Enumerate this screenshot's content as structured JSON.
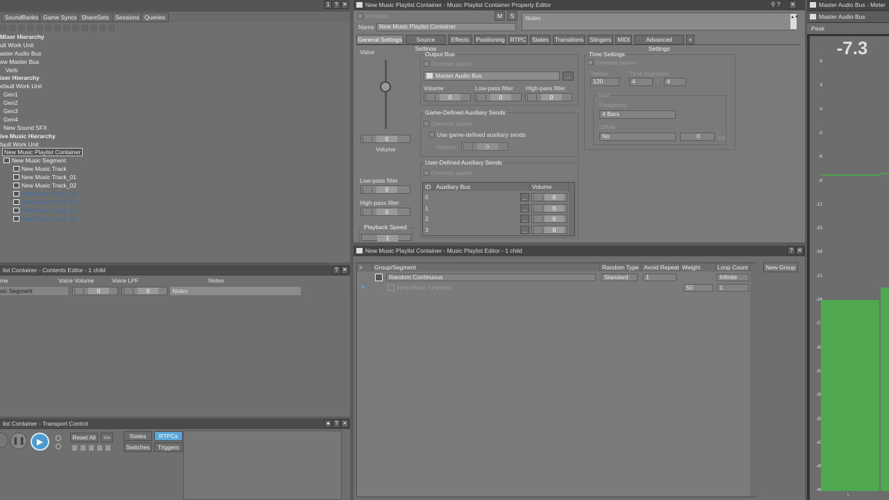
{
  "left_tabs": [
    "SoundBanks",
    "Game Syncs",
    "ShareSets",
    "Sessions",
    "Queries"
  ],
  "left_tab_buttons": [
    "1",
    "?",
    "✕"
  ],
  "tree": [
    {
      "label": "Mixer Hierarchy",
      "indent": 0,
      "bold": true,
      "icon": false,
      "blue": false
    },
    {
      "label": "ult Work Unit",
      "indent": 0,
      "bold": false,
      "icon": false,
      "blue": false
    },
    {
      "label": "aster Audio Bus",
      "indent": 0,
      "bold": false,
      "icon": false,
      "blue": false
    },
    {
      "label": "ew Master Bus",
      "indent": 0,
      "bold": false,
      "icon": false,
      "blue": false
    },
    {
      "label": "Verb",
      "indent": 8,
      "bold": false,
      "icon": false,
      "blue": false
    },
    {
      "label": "ixer Hierarchy",
      "indent": 0,
      "bold": true,
      "icon": false,
      "blue": false
    },
    {
      "label": "efault Work Unit",
      "indent": 0,
      "bold": false,
      "icon": false,
      "blue": false
    },
    {
      "label": "Gen1",
      "indent": 5,
      "bold": false,
      "icon": false,
      "blue": false
    },
    {
      "label": "Gen2",
      "indent": 5,
      "bold": false,
      "icon": false,
      "blue": false
    },
    {
      "label": "Gen3",
      "indent": 5,
      "bold": false,
      "icon": false,
      "blue": false
    },
    {
      "label": "Gen4",
      "indent": 5,
      "bold": false,
      "icon": false,
      "blue": false
    },
    {
      "label": "New Sound SFX",
      "indent": 5,
      "bold": false,
      "icon": false,
      "blue": false
    },
    {
      "label": "ive Music Hierarchy",
      "indent": 0,
      "bold": true,
      "icon": false,
      "blue": false
    },
    {
      "label": "fault Work Unit",
      "indent": 0,
      "bold": false,
      "icon": false,
      "blue": false
    },
    {
      "label": "New Music Playlist Container",
      "indent": 3,
      "bold": false,
      "icon": false,
      "blue": false,
      "selected": true
    },
    {
      "label": "New Music Segment",
      "indent": 5,
      "bold": false,
      "icon": true,
      "blue": false
    },
    {
      "label": "New Music Track",
      "indent": 19,
      "bold": false,
      "icon": true,
      "blue": false
    },
    {
      "label": "New Music Track_01",
      "indent": 19,
      "bold": false,
      "icon": true,
      "blue": false
    },
    {
      "label": "New Music Track_02",
      "indent": 19,
      "bold": false,
      "icon": true,
      "blue": false
    },
    {
      "label": "New Music Track_03",
      "indent": 19,
      "bold": false,
      "icon": true,
      "blue": true
    },
    {
      "label": "New Music Track_04",
      "indent": 19,
      "bold": false,
      "icon": true,
      "blue": true
    },
    {
      "label": "New Music Track_05",
      "indent": 19,
      "bold": false,
      "icon": true,
      "blue": true
    },
    {
      "label": "New Music Track_06",
      "indent": 19,
      "bold": false,
      "icon": true,
      "blue": true
    }
  ],
  "contents": {
    "title": "list Container - Contents Editor - 1 child",
    "col_name": "me",
    "col_voice_volume": "Voice Volume",
    "col_voice_lpf": "Voice LPF",
    "col_notes": "Notes",
    "row_name": "sic Segment",
    "row_volume": "0",
    "row_lpf": "0",
    "row_notes": "Notes"
  },
  "transport": {
    "title": "list Container - Transport Control",
    "reset_all": "Reset All",
    "more": ">>",
    "states": "States",
    "rtpcs": "RTPCs",
    "switches": "Switches",
    "triggers": "Triggers"
  },
  "prop": {
    "title": "New Music Playlist Container - Music Playlist Container Property Editor",
    "inclusion": "Inclusion",
    "m_btn": "M",
    "s_btn": "S",
    "name_label": "Name",
    "name_value": "New Music Playlist Container",
    "notes_placeholder": "Notes",
    "tabs": [
      "General Settings",
      "Source Settings",
      "Effects",
      "Positioning",
      "RTPC",
      "States",
      "Transitions",
      "Stingers",
      "MIDI",
      "Advanced Settings",
      "+"
    ],
    "voice_group": "Voice",
    "voice_volume_value": "0",
    "voice_volume_label": "Volume",
    "lpf_label": "Low-pass filter",
    "lpf_value": "0",
    "hpf_label": "High-pass filter",
    "hpf_value": "0",
    "playback_speed_label": "Playback Speed",
    "playback_speed_value": "1",
    "output_bus_group": "Output Bus",
    "override_parent": "Override parent",
    "output_bus_value": "Master Audio Bus",
    "ellipsis": "...",
    "ob_volume_label": "Volume",
    "ob_volume_value": "0",
    "ob_lpf_label": "Low-pass filter",
    "ob_lpf_value": "0",
    "ob_hpf_label": "High-pass filter",
    "ob_hpf_value": "0",
    "game_aux_group": "Game-Defined Auxiliary Sends",
    "use_game_aux": "Use game-defined auxiliary sends",
    "game_aux_volume_label": "Volume",
    "game_aux_volume_value": "0",
    "user_aux_group": "User-Defined Auxiliary Sends",
    "aux_col_id": "ID",
    "aux_col_bus": "Auxiliary Bus",
    "aux_col_volume": "Volume",
    "aux_rows": [
      {
        "id": "0",
        "volume": "0"
      },
      {
        "id": "1",
        "volume": "0"
      },
      {
        "id": "2",
        "volume": "0"
      },
      {
        "id": "3",
        "volume": "0"
      }
    ],
    "time_group": "Time Settings",
    "tempo_label": "Tempo",
    "tempo_value": "120",
    "timesig_label": "Time Signature",
    "timesig_num": "4",
    "timesig_slash": "/",
    "timesig_den": "4",
    "grid_label": "Grid",
    "frequency_label": "Frequency",
    "frequency_value": "4 Bars",
    "offset_label": "Offset",
    "offset_value": "No",
    "offset_ms_value": "0",
    "offset_ms_unit": "ms"
  },
  "playlist": {
    "title": "New Music Playlist Container - Music Playlist Editor - 1 child",
    "col_arrow": ">",
    "col_group": "Group/Segment",
    "col_random": "Random Type",
    "col_avoid": "Avoid Repeat",
    "col_weight": "Weight",
    "col_loop": "Loop Count",
    "new_group": "New Group",
    "row1_type": "Random Continuous",
    "row1_random": "Standard",
    "row1_avoid": "1",
    "row1_loop": "Infinite",
    "row2_name": "New Music Segment",
    "row2_weight": "50",
    "row2_loop": "1"
  },
  "meter": {
    "title": "Master Audio Bus - Meter",
    "bus": "Master Audio Bus",
    "mode": "Peak",
    "value": "-7.3",
    "scale": [
      {
        "label": "6",
        "v": 6
      },
      {
        "label": "3",
        "v": 3
      },
      {
        "label": "0",
        "v": 0
      },
      {
        "label": "-3",
        "v": -3
      },
      {
        "label": "-6",
        "v": -6
      },
      {
        "label": "-9",
        "v": -9
      },
      {
        "label": "-12",
        "v": -12
      },
      {
        "label": "-15",
        "v": -15
      },
      {
        "label": "-18",
        "v": -18
      },
      {
        "label": "-21",
        "v": -21
      },
      {
        "label": "-24",
        "v": -24
      },
      {
        "label": "-27",
        "v": -27
      },
      {
        "label": "-30",
        "v": -30
      },
      {
        "label": "-33",
        "v": -33
      },
      {
        "label": "-36",
        "v": -36
      },
      {
        "label": "-39",
        "v": -39
      },
      {
        "label": "-42",
        "v": -42
      },
      {
        "label": "-45",
        "v": -45
      },
      {
        "label": "-48",
        "v": -48
      }
    ],
    "bottom_label": "L",
    "green": "#4fa84f",
    "peak_line_db": -7.3,
    "bar_level_db": -24
  }
}
